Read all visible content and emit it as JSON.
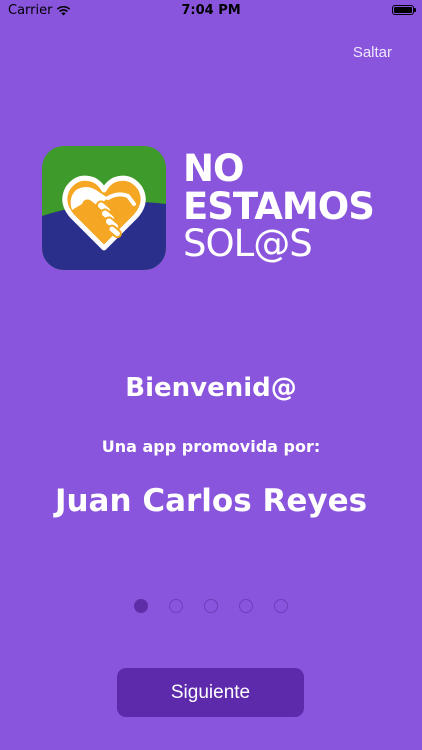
{
  "status_bar": {
    "carrier": "Carrier",
    "time": "7:04 PM",
    "wifi_icon": "wifi-icon",
    "battery_icon": "battery-icon",
    "battery_level": 1.0
  },
  "header": {
    "skip_label": "Saltar"
  },
  "logo": {
    "icon": "handshake-heart-icon",
    "line1": "NO",
    "line2": "ESTAMOS",
    "line3": "SOL@S"
  },
  "main": {
    "welcome": "Bienvenid@",
    "promoted_by": "Una app promovida por:",
    "promoter_name": "Juan Carlos Reyes"
  },
  "pager": {
    "count": 5,
    "active_index": 0
  },
  "footer": {
    "next_label": "Siguiente"
  },
  "colors": {
    "background": "#8a55dd",
    "button": "#5d2aac",
    "logo_green": "#3f9a2c",
    "logo_navy": "#2b2f8c",
    "logo_orange": "#f5a623"
  }
}
